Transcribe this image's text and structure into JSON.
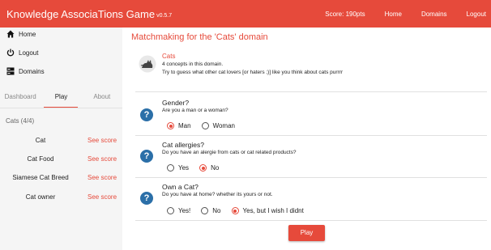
{
  "header": {
    "title": "Knowledge AssociaTions Game",
    "version": "v0.5.7",
    "score": "Score: 190pts",
    "nav": [
      "Home",
      "Domains",
      "Logout"
    ]
  },
  "sidebar": {
    "links": [
      {
        "label": "Home",
        "icon": "home-icon"
      },
      {
        "label": "Logout",
        "icon": "power-icon"
      },
      {
        "label": "Domains",
        "icon": "server-icon"
      }
    ],
    "tabs": [
      "Dashboard",
      "Play",
      "About"
    ],
    "active_tab": "Play",
    "domain_header": "Cats (4/4)",
    "concepts": [
      {
        "name": "Cat",
        "action": "See score"
      },
      {
        "name": "Cat Food",
        "action": "See score"
      },
      {
        "name": "Siamese Cat Breed",
        "action": "See score"
      },
      {
        "name": "Cat owner",
        "action": "See score"
      }
    ]
  },
  "main": {
    "title": "Matchmaking for the 'Cats' domain",
    "domain": {
      "name": "Cats",
      "line1": "4 concepts in this domain.",
      "line2": "Try to guess what other cat lovers [or haters ;)] like you think about cats purrrr"
    },
    "questions": [
      {
        "title": "Gender?",
        "desc": "Are you a man or a woman?",
        "options": [
          {
            "label": "Man",
            "checked": true
          },
          {
            "label": "Woman",
            "checked": false
          }
        ]
      },
      {
        "title": "Cat allergies?",
        "desc": "Do you have an alergie from cats or cat related products?",
        "options": [
          {
            "label": "Yes",
            "checked": false
          },
          {
            "label": "No",
            "checked": true
          }
        ]
      },
      {
        "title": "Own a Cat?",
        "desc": "Do you have at home? whether its yours or not.",
        "options": [
          {
            "label": "Yes!",
            "checked": false
          },
          {
            "label": "No",
            "checked": false
          },
          {
            "label": "Yes, but I wish I didnt",
            "checked": true
          }
        ]
      }
    ],
    "play_label": "Play"
  },
  "colors": {
    "accent": "#e64a3b",
    "question_icon": "#2b6fa8",
    "sidebar_bg": "#f5f5f5"
  }
}
